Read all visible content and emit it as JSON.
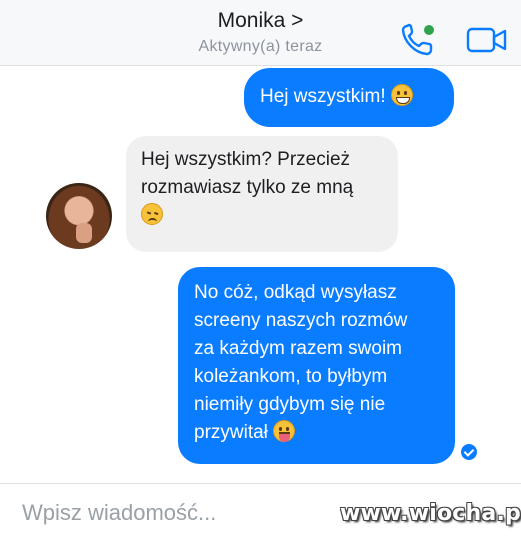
{
  "header": {
    "contact_name": "Monika >",
    "status": "Aktywny(a) teraz",
    "icons": [
      "phone-icon",
      "video-camera-icon"
    ],
    "accent": "#0a7cff"
  },
  "messages": [
    {
      "sender": "me",
      "lines": [
        "Hej wszystkim!"
      ],
      "emoji": "grinning-face"
    },
    {
      "sender": "Monika",
      "lines": [
        "Hej wszystkim? Przecież",
        "rozmawiasz tylko ze mną"
      ],
      "emoji": "disappointed-face"
    },
    {
      "sender": "me",
      "lines": [
        "No cóż, odkąd wysyłasz",
        "screeny naszych rozmów",
        "za każdym razem swoim",
        "koleżankom, to byłbym",
        "niemiły gdybym się nie",
        "przywitał"
      ],
      "emoji": "tongue-face"
    }
  ],
  "composer": {
    "placeholder": "Wpisz wiadomość..."
  },
  "watermark": "www.wiocha.pl",
  "colors": {
    "outgoing_bubble": "#0a7cff",
    "incoming_bubble": "#f1f0f0",
    "header_bg": "#f7f8fa"
  }
}
